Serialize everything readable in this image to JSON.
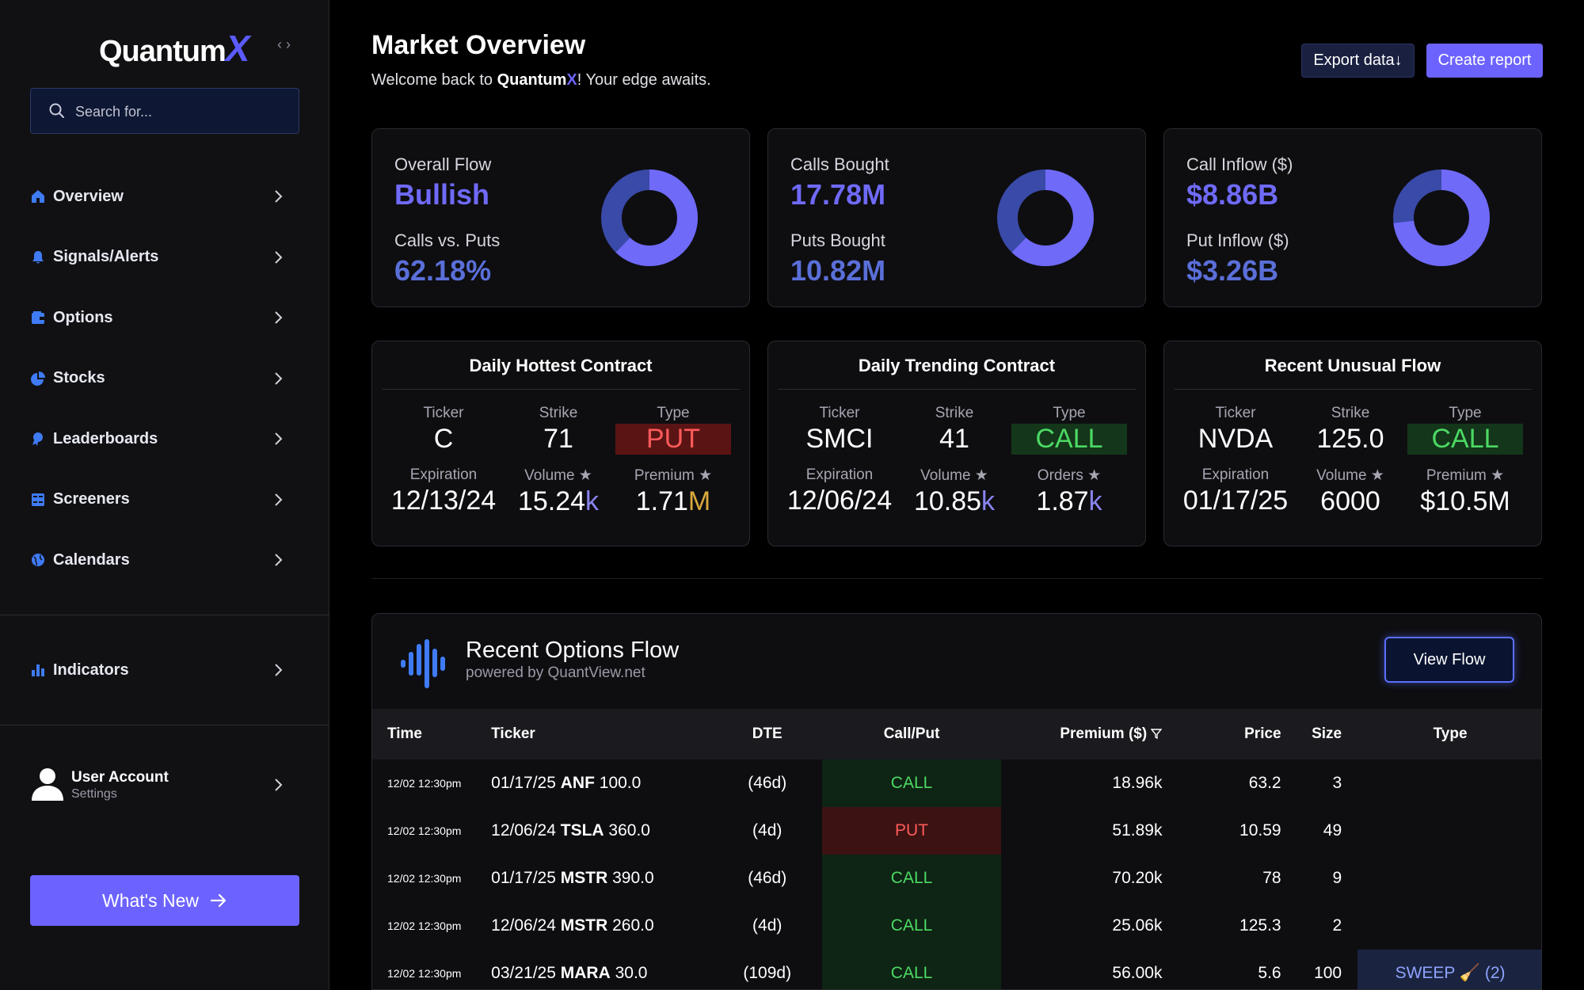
{
  "sidebar": {
    "logo_text": "Quantum",
    "logo_accent": "X",
    "search_placeholder": "Search for...",
    "items": [
      {
        "label": "Overview",
        "icon": "home-icon"
      },
      {
        "label": "Signals/Alerts",
        "icon": "bell-icon"
      },
      {
        "label": "Options",
        "icon": "wallet-icon"
      },
      {
        "label": "Stocks",
        "icon": "pie-chart-icon"
      },
      {
        "label": "Leaderboards",
        "icon": "award-icon"
      },
      {
        "label": "Screeners",
        "icon": "grid-icon"
      },
      {
        "label": "Calendars",
        "icon": "globe-icon"
      }
    ],
    "indicators_label": "Indicators",
    "user_name": "User Account",
    "user_sub": "Settings",
    "whats_new": "What's New"
  },
  "header": {
    "title": "Market Overview",
    "welcome_pre": "Welcome back to ",
    "welcome_brand": "Quantum",
    "welcome_brand_x": "X",
    "welcome_post": "! Your edge awaits.",
    "export_label": "Export data↓",
    "create_label": "Create report"
  },
  "stats": [
    {
      "label1": "Overall Flow",
      "value1": "Bullish",
      "label2": "Calls vs. Puts",
      "value2": "62.18%",
      "fraction": 0.6218
    },
    {
      "label1": "Calls Bought",
      "value1": "17.78M",
      "label2": "Puts Bought",
      "value2": "10.82M",
      "fraction": 0.6217
    },
    {
      "label1": "Call Inflow ($)",
      "value1": "$8.86B",
      "label2": "Put Inflow ($)",
      "value2": "$3.26B",
      "fraction": 0.731
    }
  ],
  "contracts": [
    {
      "title": "Daily Hottest Contract",
      "ticker_h": "Ticker",
      "ticker": "C",
      "strike_h": "Strike",
      "strike": "71",
      "type_h": "Type",
      "type": "PUT",
      "exp_h": "Expiration",
      "exp": "12/13/24",
      "vol_h": "Volume ★",
      "vol": "15.24",
      "vol_unit": "k",
      "third_h": "Premium ★",
      "third": "1.71",
      "third_unit": "M"
    },
    {
      "title": "Daily Trending Contract",
      "ticker_h": "Ticker",
      "ticker": "SMCI",
      "strike_h": "Strike",
      "strike": "41",
      "type_h": "Type",
      "type": "CALL",
      "exp_h": "Expiration",
      "exp": "12/06/24",
      "vol_h": "Volume ★",
      "vol": "10.85",
      "vol_unit": "k",
      "third_h": "Orders ★",
      "third": "1.87",
      "third_unit": "k"
    },
    {
      "title": "Recent Unusual Flow",
      "ticker_h": "Ticker",
      "ticker": "NVDA",
      "strike_h": "Strike",
      "strike": "125.0",
      "type_h": "Type",
      "type": "CALL",
      "exp_h": "Expiration",
      "exp": "01/17/25",
      "vol_h": "Volume ★",
      "vol": "6000",
      "vol_unit": "",
      "third_h": "Premium ★",
      "third": "$10.5M",
      "third_unit": ""
    }
  ],
  "flow": {
    "title": "Recent Options Flow",
    "subtitle": "powered by QuantView.net",
    "view_label": "View Flow",
    "columns": {
      "time": "Time",
      "ticker": "Ticker",
      "dte": "DTE",
      "cp": "Call/Put",
      "premium": "Premium ($)",
      "price": "Price",
      "size": "Size",
      "type": "Type"
    },
    "rows": [
      {
        "time": "12/02 12:30pm",
        "exp": "01/17/25",
        "sym": "ANF",
        "strike": "100.0",
        "dte": "(46d)",
        "cp": "CALL",
        "premium": "18.96k",
        "price": "63.2",
        "size": "3",
        "type": ""
      },
      {
        "time": "12/02 12:30pm",
        "exp": "12/06/24",
        "sym": "TSLA",
        "strike": "360.0",
        "dte": "(4d)",
        "cp": "PUT",
        "premium": "51.89k",
        "price": "10.59",
        "size": "49",
        "type": ""
      },
      {
        "time": "12/02 12:30pm",
        "exp": "01/17/25",
        "sym": "MSTR",
        "strike": "390.0",
        "dte": "(46d)",
        "cp": "CALL",
        "premium": "70.20k",
        "price": "78",
        "size": "9",
        "type": ""
      },
      {
        "time": "12/02 12:30pm",
        "exp": "12/06/24",
        "sym": "MSTR",
        "strike": "260.0",
        "dte": "(4d)",
        "cp": "CALL",
        "premium": "25.06k",
        "price": "125.3",
        "size": "2",
        "type": ""
      },
      {
        "time": "12/02 12:30pm",
        "exp": "03/21/25",
        "sym": "MARA",
        "strike": "30.0",
        "dte": "(109d)",
        "cp": "CALL",
        "premium": "56.00k",
        "price": "5.6",
        "size": "100",
        "type": "SWEEP 🧹 (2)"
      }
    ]
  },
  "colors": {
    "accent": "#6c63ff",
    "call": "#4cd964",
    "put": "#ff5a5a",
    "donut_main": "#6f6af8",
    "donut_rest": "#3a4aa8"
  }
}
